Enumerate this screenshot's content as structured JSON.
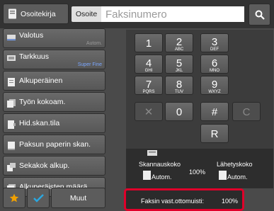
{
  "topbar": {
    "address_book_label": "Osoitekirja",
    "address_label": "Osoite",
    "fax_placeholder": "Faksinumero",
    "search_icon": "search-icon"
  },
  "list": {
    "items": [
      {
        "label": "Valotus",
        "sub": "Autom.",
        "icon": "exposure-icon"
      },
      {
        "label": "Tarkkuus",
        "sub": "Super Fine",
        "icon": "resolution-icon"
      },
      {
        "label": "Alkuperäinen",
        "sub": "",
        "icon": "original-icon"
      },
      {
        "label": "Työn kokoam.",
        "sub": "",
        "icon": "job-build-icon"
      },
      {
        "label": "Hid.skan.tila",
        "sub": "",
        "icon": "slow-scan-icon"
      },
      {
        "label": "Paksun paperin skan.",
        "sub": "",
        "icon": "thick-paper-icon"
      },
      {
        "label": "Sekakok alkup.",
        "sub": "",
        "icon": "mixed-size-icon"
      },
      {
        "label": "Alkuperäisten määrä",
        "sub": "",
        "icon": "original-count-icon"
      }
    ],
    "other_label": "Muut"
  },
  "keypad": {
    "keys": [
      {
        "num": "1",
        "let": ""
      },
      {
        "num": "2",
        "let": "ABC"
      },
      {
        "num": "3",
        "let": "DEF"
      },
      {
        "num": "4",
        "let": "GHI"
      },
      {
        "num": "5",
        "let": "JKL"
      },
      {
        "num": "6",
        "let": "MNO"
      },
      {
        "num": "7",
        "let": "PQRS"
      },
      {
        "num": "8",
        "let": "TUV"
      },
      {
        "num": "9",
        "let": "WXYZ"
      },
      {
        "num": "✕",
        "let": ""
      },
      {
        "num": "0",
        "let": ""
      },
      {
        "num": "#",
        "let": ""
      },
      {
        "num": "C",
        "let": ""
      },
      {
        "num": "R",
        "let": ""
      }
    ]
  },
  "info": {
    "scan_size_label": "Skannauskoko",
    "send_size_label": "Lähetyskoko",
    "scan_value": "Autom.",
    "send_value": "Autom.",
    "ratio": "100%",
    "memory_label": "Faksin vast.ottomuisti:",
    "memory_value": "100%"
  },
  "colors": {
    "highlight": "#e0002a",
    "star": "#f0a000",
    "check": "#2aa7e0"
  }
}
